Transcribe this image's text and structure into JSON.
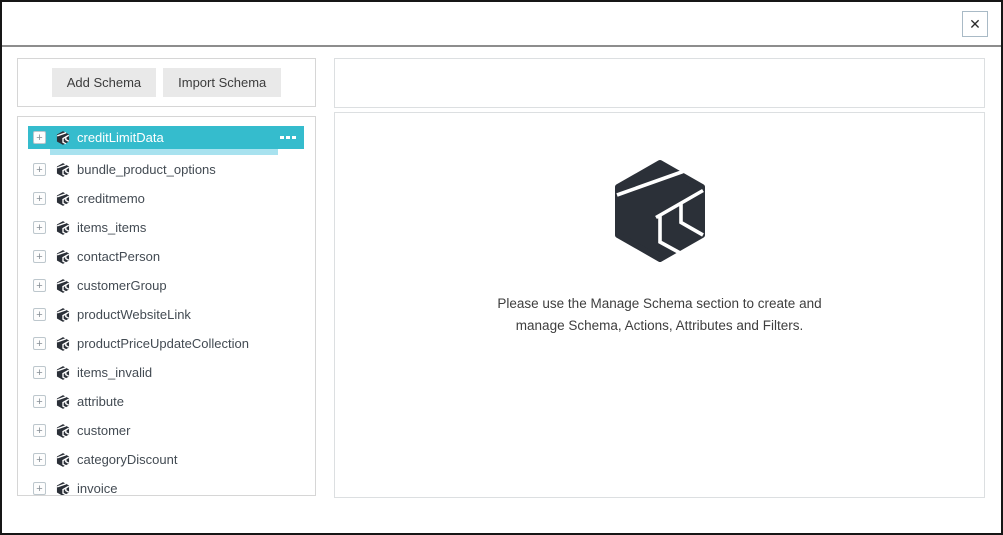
{
  "dialog": {
    "close_glyph": "✕"
  },
  "left_panel": {
    "add_button": "Add Schema",
    "import_button": "Import Schema",
    "expand_glyph": "+",
    "selected_schema": "creditLimitData",
    "schemas": [
      "creditLimitData",
      "bundle_product_options",
      "creditmemo",
      "items_items",
      "contactPerson",
      "customerGroup",
      "productWebsiteLink",
      "productPriceUpdateCollection",
      "items_invalid",
      "attribute",
      "customer",
      "categoryDiscount",
      "invoice"
    ]
  },
  "right_panel": {
    "message_line1": "Please use the Manage Schema section to create and",
    "message_line2": "manage Schema, Actions, Attributes and Filters."
  },
  "colors": {
    "accent": "#35bccd",
    "accent_light": "#a8e2ef",
    "logo_dark": "#2b3038",
    "button_bg": "#e9e9e9"
  },
  "icons": {
    "schema_row_icon": "cube-icon",
    "selected_row_menu": "ellipsis-icon",
    "expand": "plus-icon",
    "close": "x-icon"
  }
}
